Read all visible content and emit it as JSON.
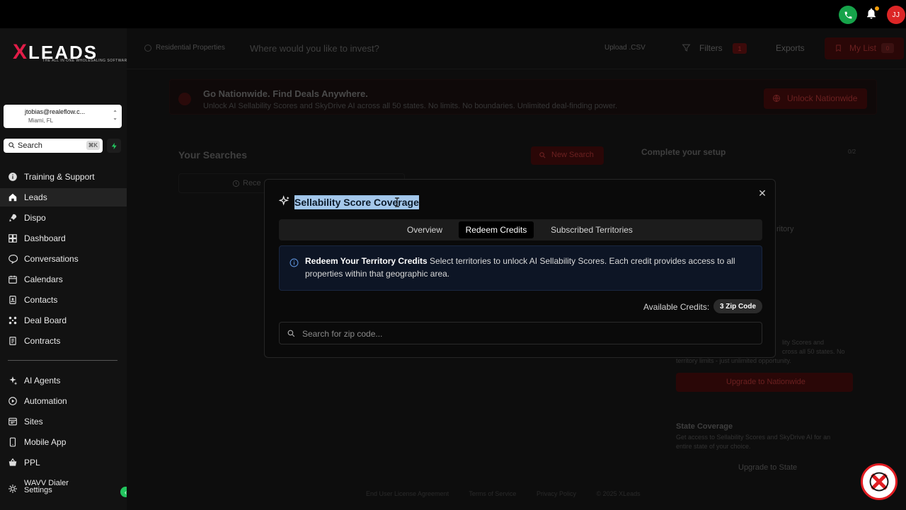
{
  "topbar": {
    "avatar_initials": "JJ"
  },
  "sidebar": {
    "logo_text": "LEADS",
    "logo_x": "X",
    "logo_tagline": "THE ALL IN ONE WHOLESALING SOFTWARE",
    "account": {
      "email": "jtobias@realeflow.c...",
      "location": "Miami, FL"
    },
    "search": {
      "label": "Search",
      "shortcut": "⌘K"
    },
    "items": [
      {
        "label": "Training & Support",
        "icon": "info-icon"
      },
      {
        "label": "Leads",
        "icon": "home-icon",
        "active": true
      },
      {
        "label": "Dispo",
        "icon": "rocket-icon"
      },
      {
        "label": "Dashboard",
        "icon": "dashboard-icon"
      },
      {
        "label": "Conversations",
        "icon": "chat-icon"
      },
      {
        "label": "Calendars",
        "icon": "calendar-icon"
      },
      {
        "label": "Contacts",
        "icon": "contacts-icon"
      },
      {
        "label": "Deal Board",
        "icon": "board-icon"
      },
      {
        "label": "Contracts",
        "icon": "contract-icon"
      },
      {
        "label": "AI Agents",
        "icon": "sparkle-icon"
      },
      {
        "label": "Automation",
        "icon": "automation-icon"
      },
      {
        "label": "Sites",
        "icon": "sites-icon"
      },
      {
        "label": "Mobile App",
        "icon": "mobile-icon"
      },
      {
        "label": "PPL",
        "icon": "basket-icon"
      },
      {
        "label": "WAVV Dialer Settings",
        "icon": "settings-icon"
      }
    ]
  },
  "main": {
    "header": {
      "property_type": "Residential Properties",
      "search_placeholder": "Where would you like to invest?",
      "upload": "Upload .CSV",
      "filters": "Filters",
      "filter_count": "1",
      "exports": "Exports",
      "my_list": "My List",
      "my_list_count": "0"
    },
    "banner": {
      "title": "Go Nationwide. Find Deals Anywhere.",
      "subtitle": "Unlock AI Sellability Scores and SkyDrive AI across all 50 states. No limits. No boundaries. Unlimited deal-finding power.",
      "cta": "Unlock Nationwide"
    },
    "your_searches": "Your Searches",
    "new_search": "New Search",
    "recent": "Rece",
    "setup": {
      "title": "Complete your setup",
      "count": "0/2",
      "territory": "ritory",
      "sell_text_1": "lity Scores and",
      "sell_text_2": "cross all 50 states. No",
      "sell_text_3": "territory limits - just unlimited opportunity.",
      "upgrade_nationwide": "Upgrade to Nationwide",
      "state_coverage": "State Coverage",
      "state_desc_1": "Get access to Sellability Scores and SkyDrive AI for an",
      "state_desc_2": "entire state of your choice.",
      "upgrade_state": "Upgrade to State"
    },
    "footer": [
      "End User License Agreement",
      "Terms of Service",
      "Privacy Policy",
      "© 2025 XLeads"
    ]
  },
  "modal": {
    "title": "Sellability Score Coverage",
    "tabs": [
      "Overview",
      "Redeem Credits",
      "Subscribed Territories"
    ],
    "active_tab": "Redeem Credits",
    "info_title": "Redeem Your Territory Credits",
    "info_text": " Select territories to unlock AI Sellability Scores. Each credit provides access to all properties within that geographic area.",
    "credits_label": "Available Credits:",
    "credits_value": "3 Zip Code",
    "zip_placeholder": "Search for zip code..."
  }
}
